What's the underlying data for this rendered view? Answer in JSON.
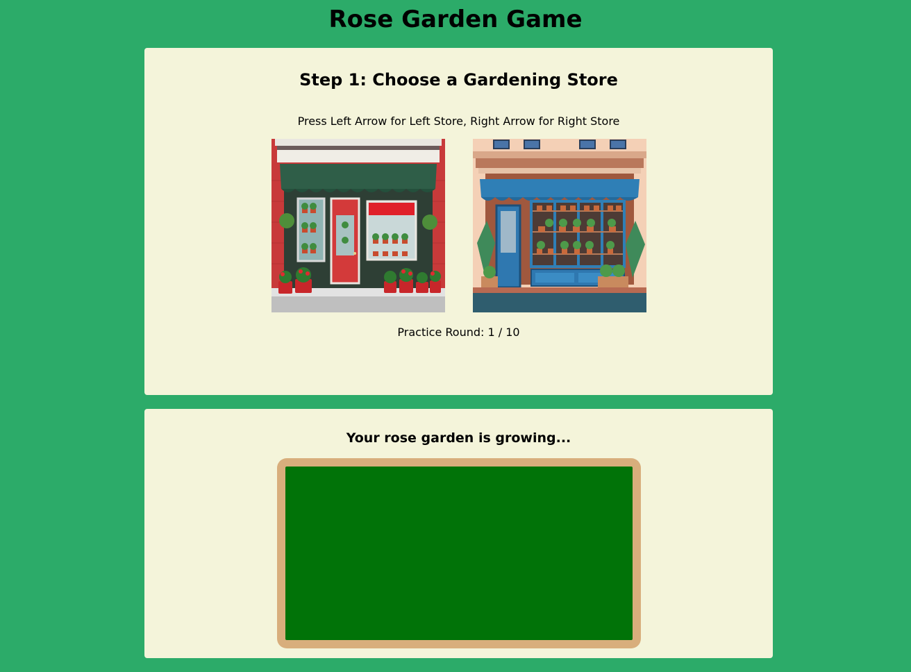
{
  "app": {
    "title": "Rose Garden Game"
  },
  "store_selection": {
    "step_title": "Step 1: Choose a Gardening Store",
    "instructions": "Press Left Arrow for Left Store, Right Arrow for Right Store",
    "stores": [
      {
        "side": "left",
        "theme": "red storefront with green awning and red flower pots"
      },
      {
        "side": "right",
        "theme": "blue storefront with blue awning and potted plants"
      }
    ],
    "round_label": "Practice Round: 1 / 10",
    "round_current": 1,
    "round_total": 10
  },
  "garden": {
    "title": "Your rose garden is growing...",
    "frame_color": "#d8ae7c",
    "bed_color": "#017308"
  },
  "colors": {
    "background": "#2cab69",
    "panel": "#f4f4da"
  }
}
